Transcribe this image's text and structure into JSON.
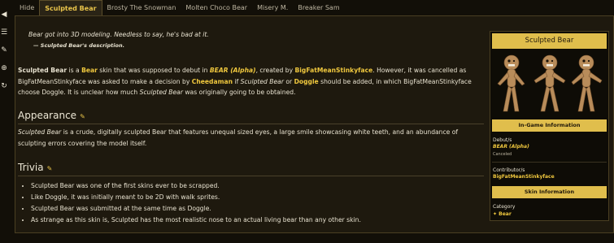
{
  "tabs": [
    "Hide",
    "Sculpted Bear",
    "Brosty The Snowman",
    "Molten Choco Bear",
    "Misery M.",
    "Breaker Sam"
  ],
  "quote": {
    "text": "Bear got into 3D modeling. Needless to say, he's bad at it.",
    "source": "— Sculpted Bear's description."
  },
  "intro": {
    "s1": "Sculpted Bear",
    "s2": " is a ",
    "s3": "Bear",
    "s4": " skin that was supposed to debut in ",
    "s5": "BEAR (Alpha)",
    "s6": ", created by ",
    "s7": "BigFatMeanStinkyface",
    "s8": ". However, it was cancelled as BigFatMeanStinkyface was asked to make a decision by ",
    "s9": "Cheedaman",
    "s10": " if ",
    "s11": "Sculpted Bear",
    "s12": " or ",
    "s13": "Doggle",
    "s14": " should be added, in which BigFatMeanStinkyface choose Doggle. It is unclear how much ",
    "s15": "Sculpted Bear",
    "s16": " was originally going to be obtained."
  },
  "appearance": {
    "heading": "Appearance",
    "edit_icon": "pencil-icon",
    "t1": "Sculpted Bear",
    "t2": " is a crude, digitally sculpted Bear that features unequal sized eyes, a large smile showcasing white teeth, and an abundance of sculpting errors covering the model itself."
  },
  "trivia": {
    "heading": "Trivia",
    "items": [
      "Sculpted Bear was one of the first skins ever to be scrapped.",
      "Like Doggle, it was initially meant to be 2D with walk sprites.",
      "Sculpted Bear was submitted at the same time as Doggle.",
      "As strange as this skin is, Sculpted has the most realistic nose to an actual living bear than any other skin."
    ]
  },
  "infobox": {
    "title": "Sculpted Bear",
    "ingame": "In-Game Information",
    "debut_label": "Debut/s",
    "debut_value": "BEAR (Alpha)",
    "debut_status": "Canceled",
    "contrib_label": "Contributor/s",
    "contrib_value": "BigFatMeanStinkyface",
    "skin_info": "Skin Information",
    "category_label": "Category",
    "category_value": "Bear"
  },
  "colors": {
    "accent": "#e0be4c",
    "link": "#f0c83e",
    "background": "#1e190e"
  }
}
